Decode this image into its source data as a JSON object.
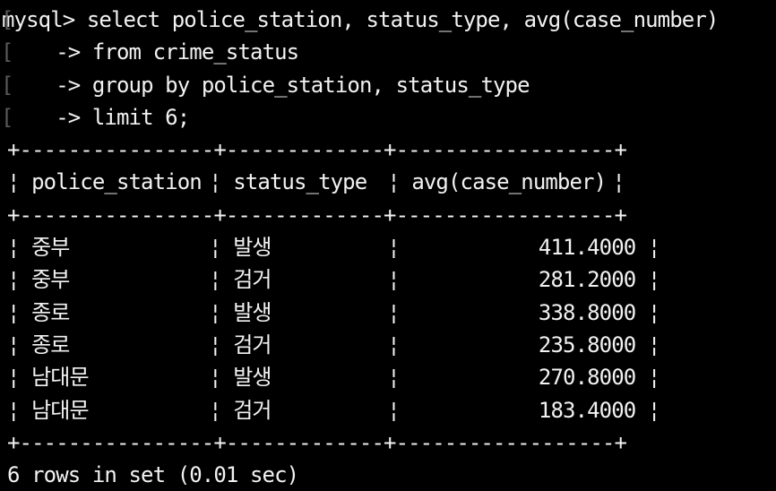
{
  "terminal": {
    "prompt": "mysql>",
    "continuation_prompt": "->",
    "continuation_marker": "[",
    "query_lines": [
      "select police_station, status_type, avg(case_number)",
      "from crime_status",
      "group by police_station, status_type",
      "limit 6;"
    ],
    "table": {
      "border": "+----------------+-------------+------------------+",
      "columns": [
        "police_station",
        "status_type",
        "avg(case_number)"
      ],
      "rows": [
        [
          "중부",
          "발생",
          "411.4000"
        ],
        [
          "중부",
          "검거",
          "281.2000"
        ],
        [
          "종로",
          "발생",
          "338.8000"
        ],
        [
          "종로",
          "검거",
          "235.8000"
        ],
        [
          "남대문",
          "발생",
          "270.8000"
        ],
        [
          "남대문",
          "검거",
          "183.4000"
        ]
      ]
    },
    "result_summary": "6 rows in set (0.01 sec)"
  },
  "colors": {
    "background": "#000000",
    "text": "#f2f2f2",
    "marker": "#5a5a5a"
  }
}
